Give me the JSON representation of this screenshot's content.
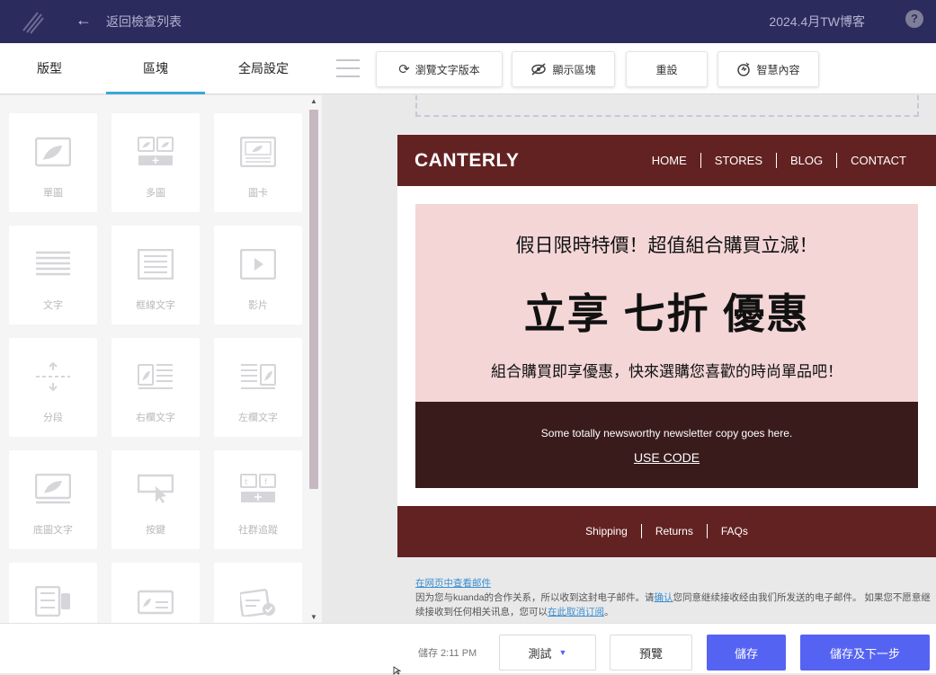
{
  "topbar": {
    "back_label": "返回檢查列表",
    "campaign_name": "2024.4月TW博客",
    "help_label": "?"
  },
  "tabs": [
    {
      "label": "版型"
    },
    {
      "label": "區塊"
    },
    {
      "label": "全局設定"
    }
  ],
  "toolbar_buttons": [
    {
      "label": "瀏覽文字版本",
      "icon": "refresh-icon"
    },
    {
      "label": "顯示區塊",
      "icon": "eye-off-icon"
    },
    {
      "label": "重設",
      "icon": ""
    },
    {
      "label": "智慧內容",
      "icon": "smart-content-icon"
    }
  ],
  "blocks": [
    {
      "label": "單圖",
      "icon": "single-image-icon"
    },
    {
      "label": "多圖",
      "icon": "multi-image-icon"
    },
    {
      "label": "圖卡",
      "icon": "image-card-icon"
    },
    {
      "label": "文字",
      "icon": "text-icon"
    },
    {
      "label": "框線文字",
      "icon": "boxed-text-icon"
    },
    {
      "label": "影片",
      "icon": "video-icon"
    },
    {
      "label": "分段",
      "icon": "divider-icon"
    },
    {
      "label": "右欄文字",
      "icon": "right-column-text-icon"
    },
    {
      "label": "左欄文字",
      "icon": "left-column-text-icon"
    },
    {
      "label": "底圖文字",
      "icon": "background-image-text-icon"
    },
    {
      "label": "按鍵",
      "icon": "button-icon"
    },
    {
      "label": "社群追蹤",
      "icon": "social-follow-icon"
    },
    {
      "label": "",
      "icon": "social-share-icon"
    },
    {
      "label": "",
      "icon": "image-group-icon"
    },
    {
      "label": "",
      "icon": "product-card-icon"
    }
  ],
  "email": {
    "brand": "CANTERLY",
    "nav": [
      "HOME",
      "STORES",
      "BLOG",
      "CONTACT"
    ],
    "promo_line1": "假日限時特價！超值組合購買立減！",
    "promo_line2": "立享 七折 優惠",
    "promo_line3": "組合購買即享優惠，快來選購您喜歡的時尚單品吧！",
    "newsletter_copy": "Some totally newsworthy newsletter copy goes here.",
    "use_code": "USE CODE",
    "footer_links": [
      "Shipping",
      "Returns",
      "FAQs"
    ]
  },
  "legal": {
    "view_online": "在网页中查看邮件",
    "text_a": "因为您与kuanda的合作关系，所以收到这封电子邮件。请",
    "confirm_link": "确认",
    "text_b": "您同意继续接收经由我们所发送的电子邮件。 如果您不愿意继续接收到任何相关讯息，您可以",
    "unsubscribe_link": "在此取消订阅",
    "text_c": "。"
  },
  "bottombar": {
    "saved_text": "儲存 2:11 PM",
    "test_label": "測試",
    "preview_label": "預覽",
    "save_label": "儲存",
    "save_next_label": "儲存及下一步"
  },
  "colors": {
    "topbar": "#2c2b5e",
    "email_header": "#632222",
    "promo_bg": "#f4d6d7",
    "dark_box": "#3a1b1c",
    "primary_button": "#5563f3",
    "active_tab": "#3aa7d6"
  }
}
